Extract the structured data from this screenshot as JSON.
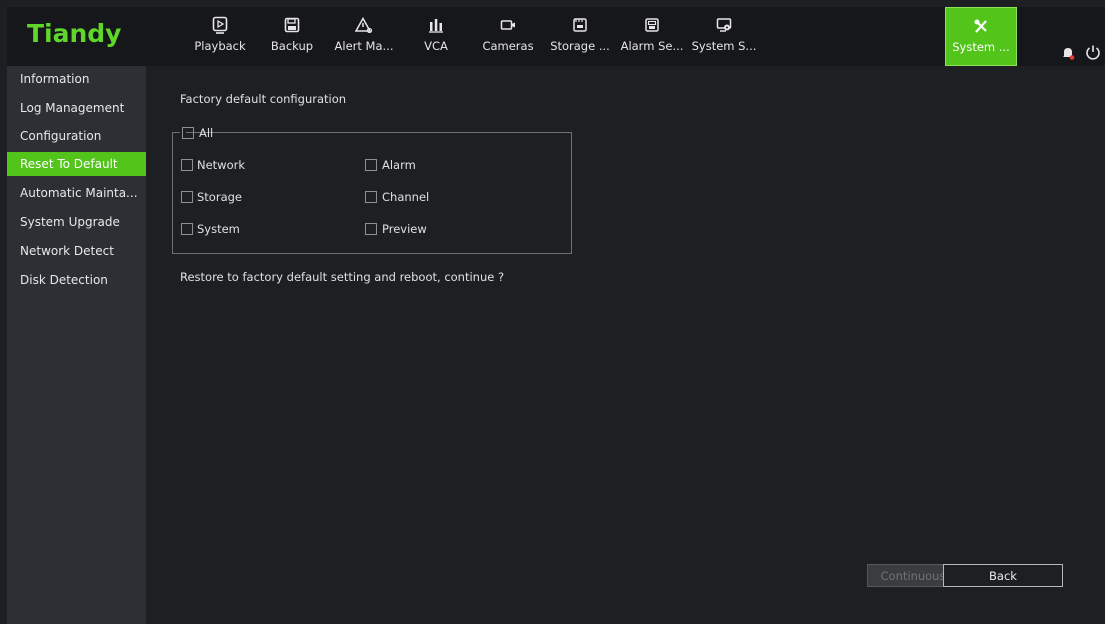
{
  "app": {
    "brand": "Tiandy",
    "accent_color": "#52c41a"
  },
  "nav": [
    {
      "label": "Playback",
      "icon": "playback-icon"
    },
    {
      "label": "Backup",
      "icon": "floppy-disk-icon"
    },
    {
      "label": "Alert Ma...",
      "icon": "alert-triangle-icon"
    },
    {
      "label": "VCA",
      "icon": "vca-chart-icon"
    },
    {
      "label": "Cameras",
      "icon": "camera-icon"
    },
    {
      "label": "Storage ...",
      "icon": "storage-icon"
    },
    {
      "label": "Alarm Se...",
      "icon": "alarm-settings-icon"
    },
    {
      "label": "System S...",
      "icon": "system-settings-icon"
    },
    {
      "label": "System ...",
      "icon": "tools-icon",
      "active": true
    }
  ],
  "sidebar": [
    {
      "label": "Information"
    },
    {
      "label": "Log Management"
    },
    {
      "label": "Configuration"
    },
    {
      "label": "Reset To Default",
      "active": true
    },
    {
      "label": "Automatic Mainta..."
    },
    {
      "label": "System Upgrade"
    },
    {
      "label": "Network Detect"
    },
    {
      "label": "Disk Detection"
    }
  ],
  "main": {
    "heading": "Factory default configuration",
    "all_label": "All",
    "options": [
      {
        "label": "Network",
        "checked": false
      },
      {
        "label": "Alarm",
        "checked": false
      },
      {
        "label": "Storage",
        "checked": false
      },
      {
        "label": "Channel",
        "checked": false
      },
      {
        "label": "System",
        "checked": false
      },
      {
        "label": "Preview",
        "checked": false
      }
    ],
    "message": "Restore to factory default setting and reboot, continue ?",
    "continue_label": "Continuous",
    "back_label": "Back"
  }
}
